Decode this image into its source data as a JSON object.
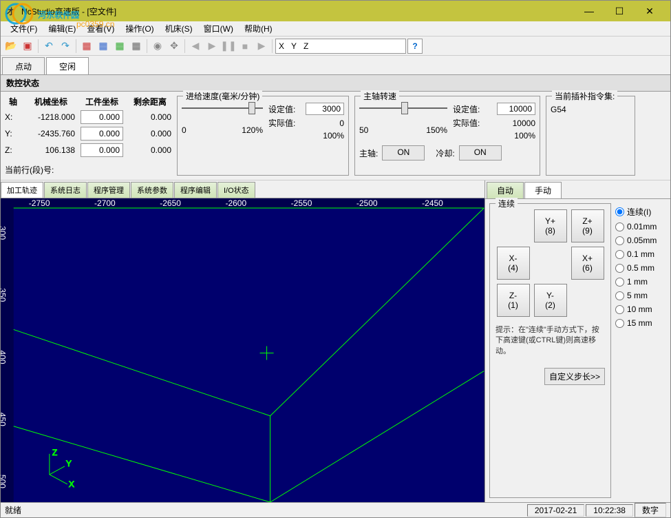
{
  "window": {
    "title": "NcStudio高速版 - [空文件]"
  },
  "menus": [
    "文件(F)",
    "编辑(E)",
    "查看(V)",
    "操作(O)",
    "机床(S)",
    "窗口(W)",
    "帮助(H)"
  ],
  "toolbar_icons": [
    "folder-open",
    "stop-box",
    "arrow-left",
    "arrow-right",
    "doc-red",
    "doc-blue",
    "doc-green",
    "grid",
    "origin",
    "move",
    "backward",
    "play",
    "pause",
    "stop",
    "forward"
  ],
  "coord_bar": {
    "x": "X",
    "y": "Y",
    "z": "Z"
  },
  "status_tabs": {
    "t1": "点动",
    "t2": "空闲"
  },
  "nc_header": "数控状态",
  "coords": {
    "hdr_axis": "轴",
    "hdr_mach": "机械坐标",
    "hdr_work": "工件坐标",
    "hdr_rem": "剩余距离",
    "rows": [
      {
        "a": "X:",
        "m": "-1218.000",
        "w": "0.000",
        "r": "0.000"
      },
      {
        "a": "Y:",
        "m": "-2435.760",
        "w": "0.000",
        "r": "0.000"
      },
      {
        "a": "Z:",
        "m": "106.138",
        "w": "0.000",
        "r": "0.000"
      }
    ],
    "cur_line_lbl": "当前行(段)号:"
  },
  "feed": {
    "title": "进给速度(毫米/分钟)",
    "min": "0",
    "max": "120%",
    "set_lbl": "设定值:",
    "set_v": "3000",
    "act_lbl": "实际值:",
    "act_v": "0",
    "pct": "100%"
  },
  "spindle": {
    "title": "主轴转速",
    "min": "50",
    "max": "150%",
    "set_lbl": "设定值:",
    "set_v": "10000",
    "act_lbl": "实际值:",
    "act_v": "10000",
    "pct": "100%",
    "sp_lbl": "主轴:",
    "sp_btn": "ON",
    "cool_lbl": "冷却:",
    "cool_btn": "ON"
  },
  "instr": {
    "title": "当前插补指令集:",
    "val": "G54"
  },
  "mid_tabs": [
    "加工轨迹",
    "系统日志",
    "程序管理",
    "系统参数",
    "程序编辑",
    "I/O状态"
  ],
  "ruler_x": [
    "-2750",
    "-2700",
    "-2650",
    "-2600",
    "-2550",
    "-2500",
    "-2450"
  ],
  "ruler_y": [
    "300",
    "350",
    "400",
    "450",
    "500"
  ],
  "axes": {
    "x": "X",
    "y": "Y",
    "z": "Z"
  },
  "right_tabs": {
    "auto": "自动",
    "manual": "手动"
  },
  "jog": {
    "title": "连续",
    "btns": {
      "yp": "Y+\n(8)",
      "zp": "Z+\n(9)",
      "xm": "X-\n(4)",
      "xp": "X+\n(6)",
      "zm": "Z-\n(1)",
      "ym": "Y-\n(2)"
    },
    "hint": "提示：在\"连续\"手动方式下，按下高速键(或CTRL键)则高速移动。",
    "custom": "自定义步长>>"
  },
  "steps": [
    "连续(I)",
    "0.01mm",
    "0.05mm",
    "0.1 mm",
    "0.5 mm",
    "1   mm",
    "5   mm",
    "10  mm",
    "15  mm"
  ],
  "status": {
    "ready": "就绪",
    "date": "2017-02-21",
    "time": "10:22:38",
    "num": "数字"
  }
}
